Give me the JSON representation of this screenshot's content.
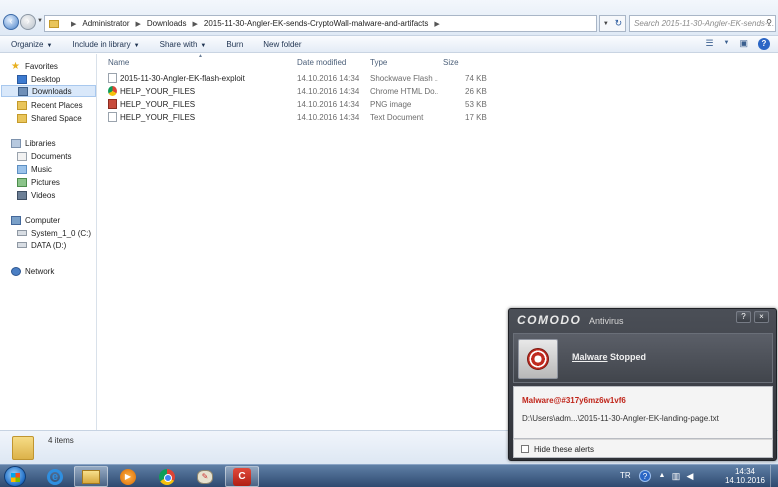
{
  "address_bar": {
    "breadcrumbs": [
      "Administrator",
      "Downloads",
      "2015-11-30-Angler-EK-sends-CryptoWall-malware-and-artifacts"
    ],
    "search_placeholder": "Search 2015-11-30-Angler-EK-sends-...",
    "back_icon": "back-arrow-icon",
    "forward_icon": "forward-arrow-icon"
  },
  "toolbar": {
    "organize": "Organize",
    "include_in_library": "Include in library",
    "share_with": "Share with",
    "burn": "Burn",
    "new_folder": "New folder"
  },
  "nav": {
    "favorites_label": "Favorites",
    "favorites": [
      "Desktop",
      "Downloads",
      "Recent Places",
      "Shared Space"
    ],
    "libraries_label": "Libraries",
    "libraries": [
      "Documents",
      "Music",
      "Pictures",
      "Videos"
    ],
    "computer_label": "Computer",
    "drives": [
      "System_1_0 (C:)",
      "DATA (D:)"
    ],
    "network_label": "Network",
    "selected": "Downloads"
  },
  "files": {
    "columns": [
      "Name",
      "Date modified",
      "Type",
      "Size"
    ],
    "rows": [
      {
        "name": "2015-11-30-Angler-EK-flash-exploit",
        "date": "14.10.2016 14:34",
        "type": "Shockwave Flash ...",
        "size": "74 KB",
        "icon": "flash-file-icon"
      },
      {
        "name": "HELP_YOUR_FILES",
        "date": "14.10.2016 14:34",
        "type": "Chrome HTML Do...",
        "size": "26 KB",
        "icon": "chrome-html-icon"
      },
      {
        "name": "HELP_YOUR_FILES",
        "date": "14.10.2016 14:34",
        "type": "PNG image",
        "size": "53 KB",
        "icon": "png-image-icon"
      },
      {
        "name": "HELP_YOUR_FILES",
        "date": "14.10.2016 14:34",
        "type": "Text Document",
        "size": "17 KB",
        "icon": "text-file-icon"
      }
    ]
  },
  "details": {
    "item_count": "4 items"
  },
  "comodo": {
    "brand": "COMODO",
    "product": "Antivirus",
    "help": "?",
    "close": "×",
    "status_link": "Malware",
    "status_rest": " Stopped",
    "malware_name": "Malware@#317y6mz6w1vf6",
    "file_path": "D:\\Users\\adm...\\2015-11-30-Angler-EK-landing-page.txt",
    "hide_alerts": "Hide these alerts"
  },
  "taskbar": {
    "language": "TR",
    "time": "14:34",
    "date": "14.10.2016",
    "apps": [
      "internet-explorer-icon",
      "windows-explorer-icon",
      "media-player-icon",
      "chrome-icon",
      "paint-icon",
      "comodo-icon"
    ]
  },
  "colors": {
    "comodo_red": "#c0251a",
    "selection": "#d9e8fa",
    "taskbar": "#2e4a70"
  }
}
